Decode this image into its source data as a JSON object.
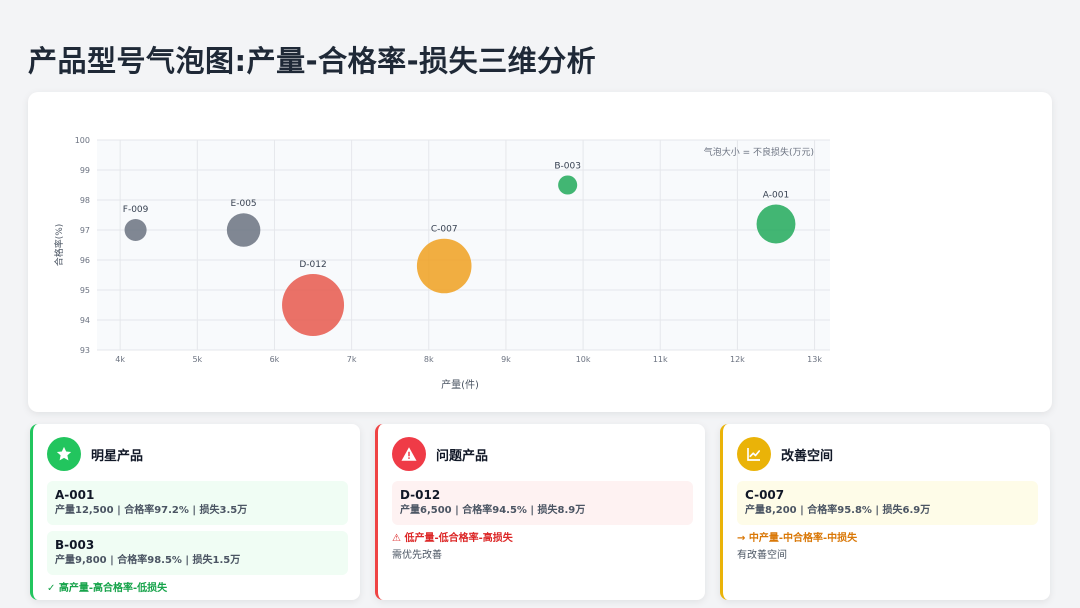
{
  "page": {
    "title": "产品型号气泡图:产量-合格率-损失三维分析"
  },
  "chart_data": {
    "type": "scatter",
    "xlabel": "产量(件)",
    "ylabel": "合格率(%)",
    "size_legend": "气泡大小 = 不良损失(万元)",
    "xlim": [
      3700,
      13200
    ],
    "ylim": [
      93,
      100
    ],
    "x_ticks": [
      4000,
      5000,
      6000,
      7000,
      8000,
      9000,
      10000,
      11000,
      12000,
      13000
    ],
    "x_tick_labels": [
      "4k",
      "5k",
      "6k",
      "7k",
      "8k",
      "9k",
      "10k",
      "11k",
      "12k",
      "13k"
    ],
    "y_ticks": [
      93,
      94,
      95,
      96,
      97,
      98,
      99,
      100
    ],
    "y_tick_labels": [
      "93",
      "94",
      "95",
      "96",
      "97",
      "98",
      "99",
      "100"
    ],
    "grid": true,
    "points": [
      {
        "label": "A-001",
        "x": 12500,
        "y": 97.2,
        "loss": 3.5,
        "color": "#22a95b"
      },
      {
        "label": "B-003",
        "x": 9800,
        "y": 98.5,
        "loss": 1.5,
        "color": "#22a95b"
      },
      {
        "label": "C-007",
        "x": 8200,
        "y": 95.8,
        "loss": 6.9,
        "color": "#f0a020"
      },
      {
        "label": "D-012",
        "x": 6500,
        "y": 94.5,
        "loss": 8.9,
        "color": "#e8584c"
      },
      {
        "label": "E-005",
        "x": 5600,
        "y": 97.0,
        "loss": 2.6,
        "color": "#6b7280"
      },
      {
        "label": "F-009",
        "x": 4200,
        "y": 97.0,
        "loss": 2.0,
        "color": "#6b7280"
      }
    ]
  },
  "cards": {
    "star": {
      "title": "明星产品",
      "icon": "star-icon",
      "accent": "#22c55e",
      "items": [
        {
          "name": "A-001",
          "stats": "产量12,500 | 合格率97.2% | 损失3.5万"
        },
        {
          "name": "B-003",
          "stats": "产量9,800 | 合格率98.5% | 损失1.5万"
        }
      ],
      "tag": "✓ 高产量-高合格率-低损失"
    },
    "problem": {
      "title": "问题产品",
      "icon": "warning-icon",
      "accent": "#ef4444",
      "items": [
        {
          "name": "D-012",
          "stats": "产量6,500 | 合格率94.5% | 损失8.9万"
        }
      ],
      "tag": "⚠ 低产量-低合格率-高损失",
      "note": "需优先改善"
    },
    "improve": {
      "title": "改善空间",
      "icon": "trend-chart-icon",
      "accent": "#eab308",
      "items": [
        {
          "name": "C-007",
          "stats": "产量8,200 | 合格率95.8% | 损失6.9万"
        }
      ],
      "tag": "→ 中产量-中合格率-中损失",
      "note": "有改善空间"
    }
  }
}
